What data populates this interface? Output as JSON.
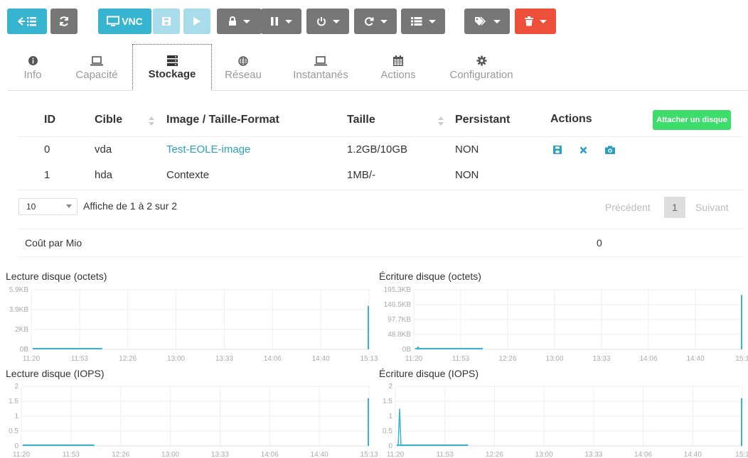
{
  "toolbar": {
    "vnc_label": "VNC"
  },
  "tabs": [
    {
      "label": "Info",
      "icon": "info-icon"
    },
    {
      "label": "Capacité",
      "icon": "laptop-icon"
    },
    {
      "label": "Stockage",
      "icon": "server-icon"
    },
    {
      "label": "Réseau",
      "icon": "globe-icon"
    },
    {
      "label": "Instantanés",
      "icon": "laptop-icon"
    },
    {
      "label": "Actions",
      "icon": "calendar-icon"
    },
    {
      "label": "Configuration",
      "icon": "gear-icon"
    }
  ],
  "storage": {
    "headers": {
      "id": "ID",
      "target": "Cible",
      "image": "Image / Taille-Format",
      "size": "Taille",
      "persistent": "Persistant",
      "actions": "Actions"
    },
    "attach_label": "Attacher un disque",
    "rows": [
      {
        "id": "0",
        "target": "vda",
        "image": "Test-EOLE-image",
        "size": "1.2GB/10GB",
        "persistent": "NON"
      },
      {
        "id": "1",
        "target": "hda",
        "image": "Contexte",
        "size": "1MB/-",
        "persistent": "NON"
      }
    ],
    "page_size": "10",
    "info": "Affiche de 1 à 2 sur 2",
    "prev_label": "Précédent",
    "page": "1",
    "next_label": "Suivant",
    "cost_label": "Coût par Mio",
    "cost_value": "0"
  },
  "colors": {
    "accent": "#36b4d0",
    "success": "#3ddc6b",
    "danger": "#ee4f3b",
    "toolbar_gray": "#777777"
  },
  "chart_data": [
    {
      "type": "line",
      "title": "Lecture disque (octets)",
      "x": [
        "11:20",
        "11:53",
        "12:26",
        "13:00",
        "13:33",
        "14:06",
        "14:40",
        "15:13"
      ],
      "y_ticks": [
        "0B",
        "2KB",
        "3.9KB",
        "5.9KB"
      ],
      "ylim": [
        0,
        5.9
      ],
      "series": [
        {
          "values": [
            0,
            0,
            0,
            0,
            0,
            0,
            0,
            4.3
          ]
        }
      ]
    },
    {
      "type": "line",
      "title": "Écriture disque (octets)",
      "x": [
        "11:20",
        "11:53",
        "12:26",
        "13:00",
        "13:33",
        "14:06",
        "14:40",
        "15:1"
      ],
      "y_ticks": [
        "0B",
        "48.8KB",
        "97.7KB",
        "146.5KB",
        "195.3KB"
      ],
      "ylim": [
        0,
        195.3
      ],
      "series": [
        {
          "values": [
            8,
            0,
            0,
            0,
            0,
            0,
            0,
            178
          ]
        }
      ]
    },
    {
      "type": "line",
      "title": "Lecture disque (IOPS)",
      "x": [
        "11:20",
        "11:53",
        "12:26",
        "13:00",
        "13:33",
        "14:06",
        "14:40",
        "15:13"
      ],
      "y_ticks": [
        "0",
        "0.5",
        "1",
        "1.5",
        "2"
      ],
      "ylim": [
        0,
        2
      ],
      "series": [
        {
          "values": [
            0,
            0,
            0,
            0,
            0,
            0,
            0,
            1.6
          ]
        }
      ]
    },
    {
      "type": "line",
      "title": "Écriture disque (IOPS)",
      "x": [
        "11:20",
        "11:53",
        "12:26",
        "13:00",
        "13:33",
        "14:06",
        "14:40",
        "15:1"
      ],
      "y_ticks": [
        "0",
        "0.5",
        "1",
        "1.5",
        "2"
      ],
      "ylim": [
        0,
        2
      ],
      "series": [
        {
          "values": [
            1.25,
            0,
            0,
            0,
            0,
            0,
            0,
            1.6
          ]
        }
      ]
    }
  ]
}
